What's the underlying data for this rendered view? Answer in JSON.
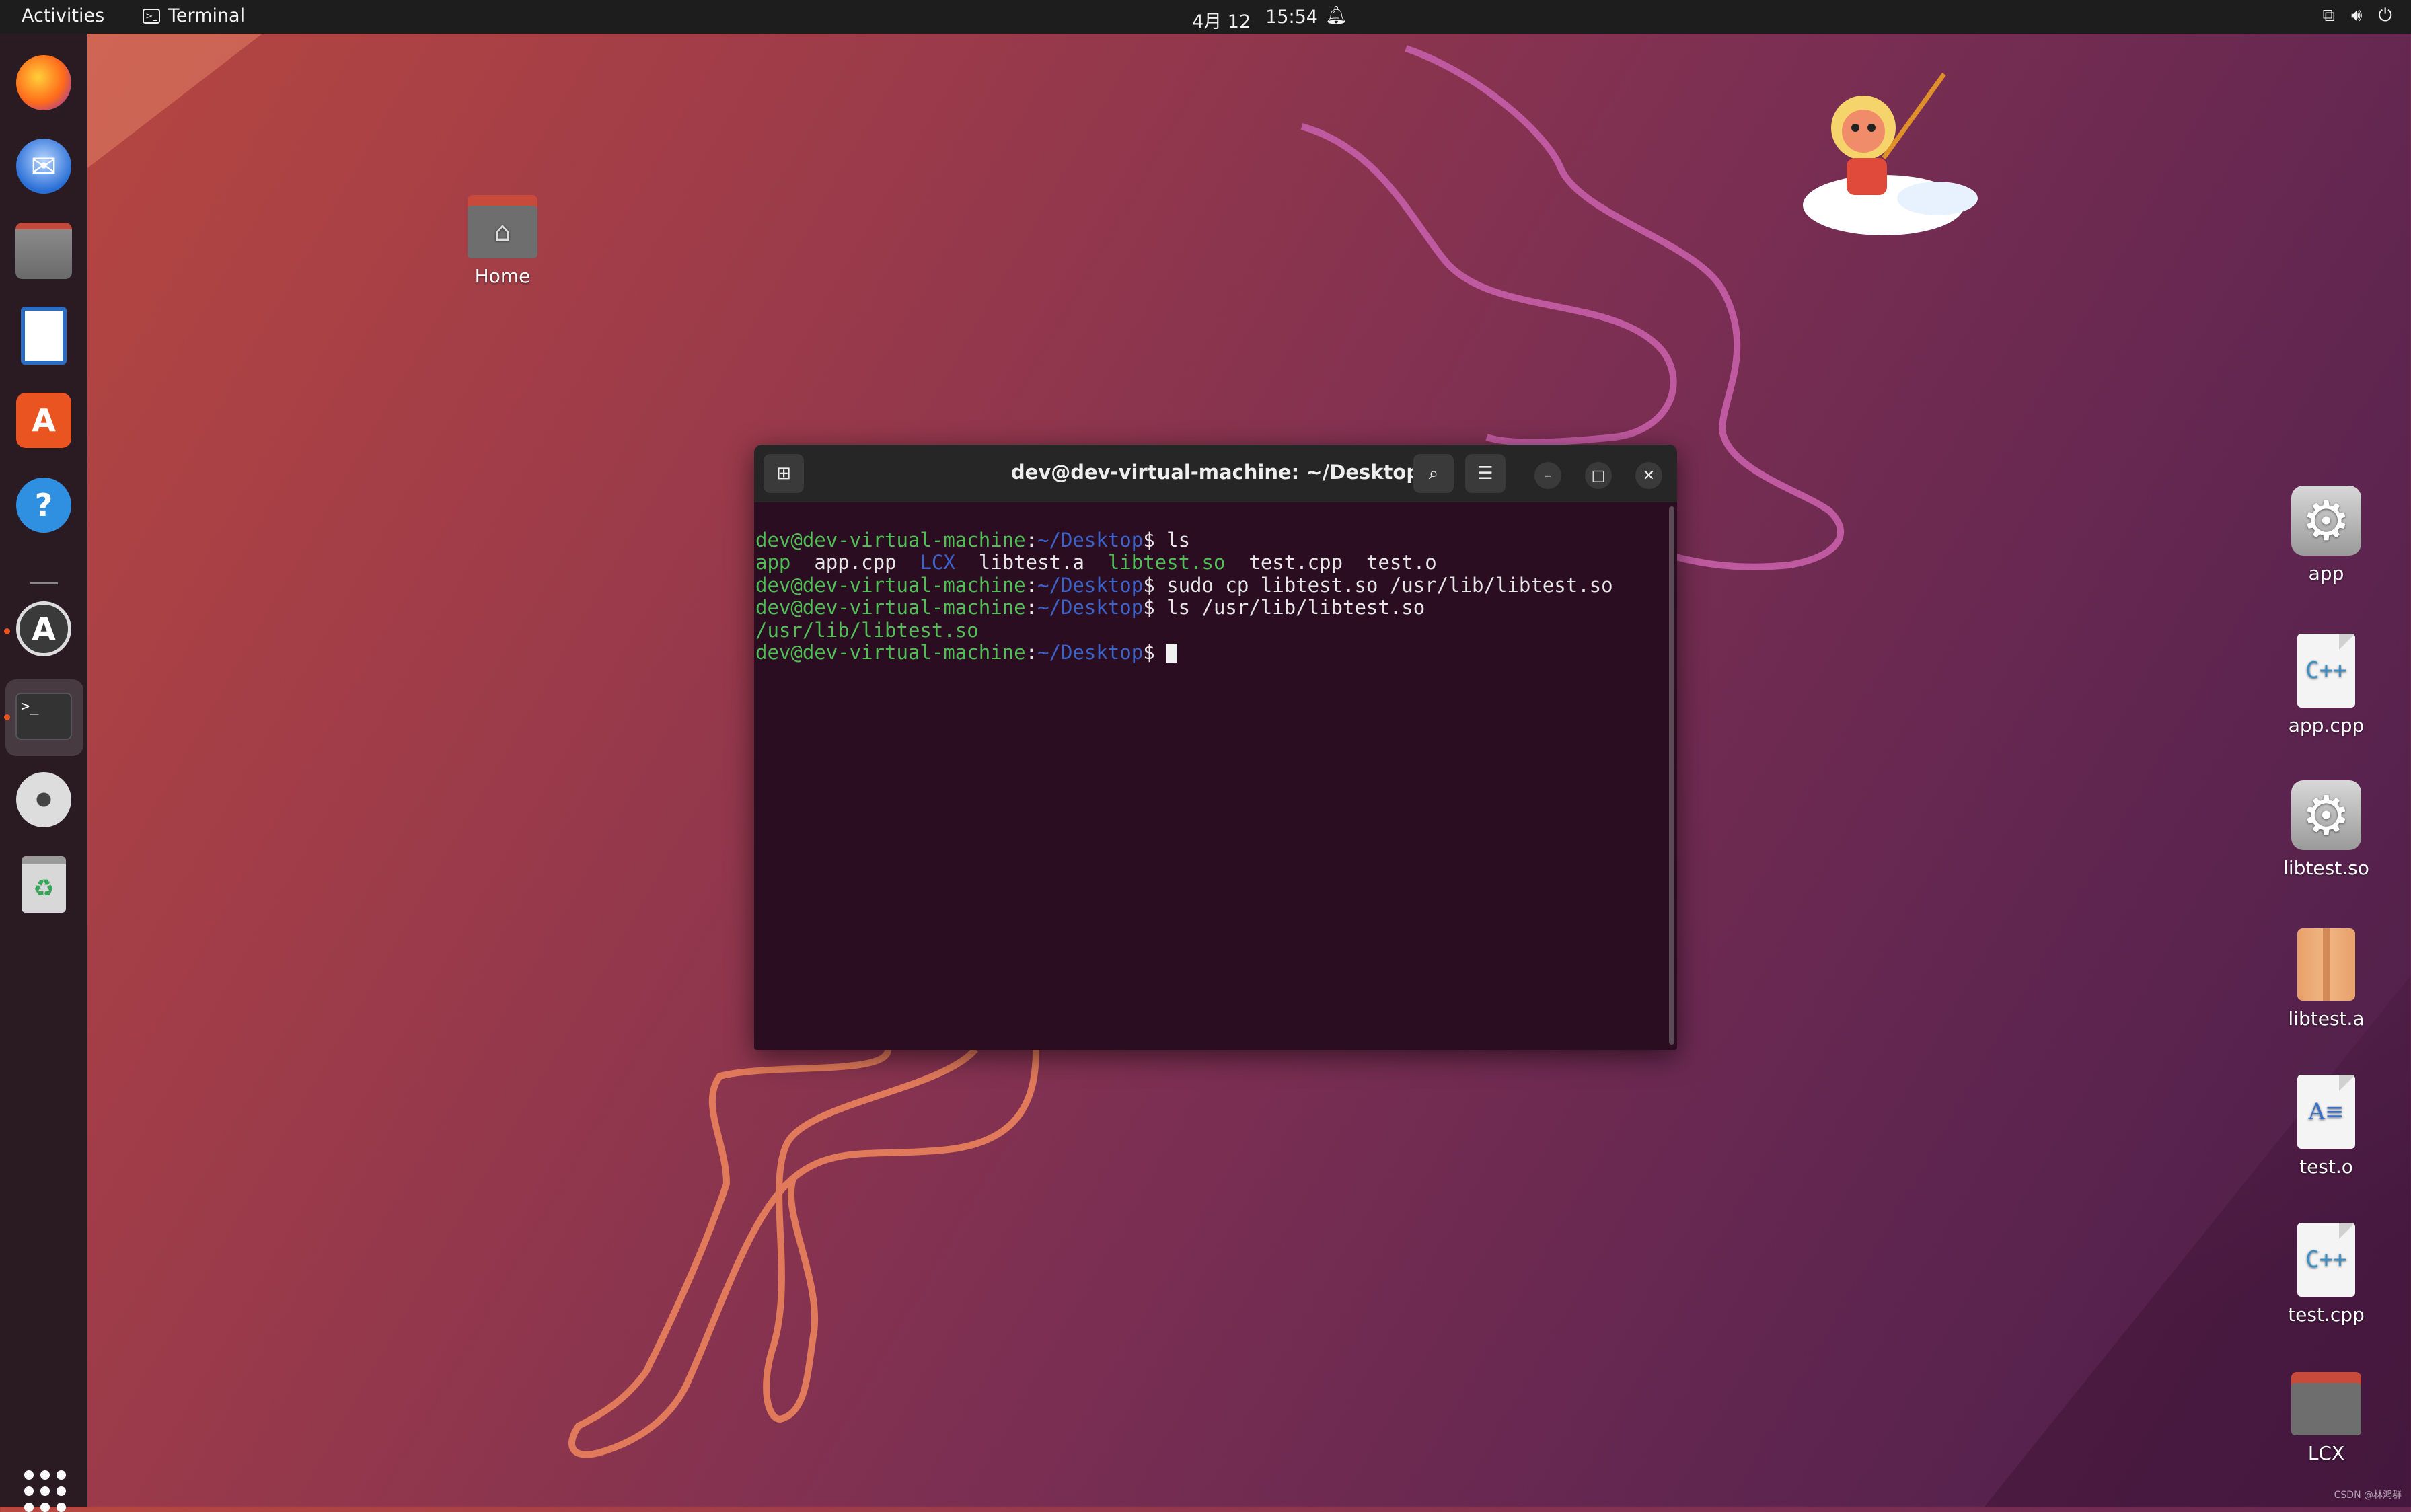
{
  "topbar": {
    "activities": "Activities",
    "app_name": "Terminal",
    "clock": {
      "date": "4月 12",
      "time": "15:54"
    }
  },
  "dock": {
    "items": [
      {
        "name": "firefox-icon"
      },
      {
        "name": "thunderbird-icon"
      },
      {
        "name": "files-icon"
      },
      {
        "name": "libreoffice-writer-icon"
      },
      {
        "name": "app-center-icon"
      },
      {
        "name": "help-icon"
      },
      {
        "name": "software-updater-icon"
      },
      {
        "name": "terminal-icon"
      },
      {
        "name": "disc-icon"
      },
      {
        "name": "trash-icon"
      }
    ]
  },
  "desktop": {
    "home_label": "Home",
    "icons": [
      {
        "label": "app",
        "type": "gear"
      },
      {
        "label": "app.cpp",
        "type": "cpp",
        "glyph": "C++"
      },
      {
        "label": "libtest.so",
        "type": "gear"
      },
      {
        "label": "libtest.a",
        "type": "pkg"
      },
      {
        "label": "test.o",
        "type": "doc",
        "glyph": "A≡"
      },
      {
        "label": "test.cpp",
        "type": "cpp",
        "glyph": "C++"
      },
      {
        "label": "LCX",
        "type": "folder"
      }
    ]
  },
  "terminal": {
    "title": "dev@dev-virtual-machine: ~/Desktop",
    "prompt_user": "dev@dev-virtual-machine",
    "prompt_path": "~/Desktop",
    "lines": {
      "cmd1": "$ ls",
      "ls_app": "app",
      "ls_appcpp": "app.cpp",
      "ls_lcx": "LCX",
      "ls_liba": "libtest.a",
      "ls_libso": "libtest.so",
      "ls_testcpp": "test.cpp",
      "ls_testo": "test.o",
      "cmd2": "$ sudo cp libtest.so /usr/lib/libtest.so",
      "cmd3": "$ ls /usr/lib/libtest.so",
      "out3": "/usr/lib/libtest.so",
      "cmd4": "$ "
    }
  },
  "watermark": "CSDN @林鸿群",
  "colors": {
    "accent": "#e95420",
    "prompt_green": "#4fbf56",
    "prompt_blue": "#3b63c9",
    "term_bg": "#2b0d22"
  }
}
